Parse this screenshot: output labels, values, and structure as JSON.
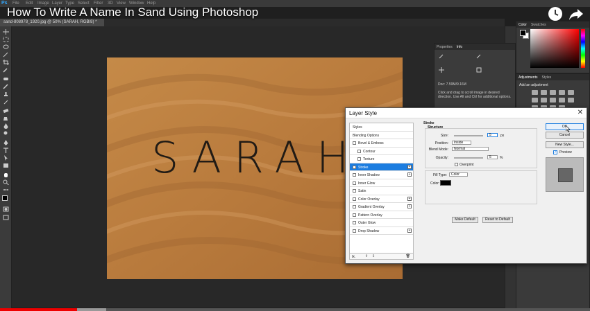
{
  "video": {
    "title": "How To Write A Name In Sand Using Photoshop",
    "progress_fraction": 0.13,
    "buffered_fraction": 0.18
  },
  "app": {
    "logo": "Ps",
    "menus": [
      "File",
      "Edit",
      "Image",
      "Layer",
      "Type",
      "Select",
      "Filter",
      "3D",
      "View",
      "Window",
      "Help"
    ],
    "doc_tab": "sand-808978_1920.jpg @ 50% (SARAH, RGB/8) *"
  },
  "canvas": {
    "word": "SARAH"
  },
  "panels": {
    "color_tabs": [
      "Color",
      "Swatches"
    ],
    "properties_tabs": [
      "Properties",
      "Info"
    ],
    "info_doc": "Doc: 7.59M/9.16M",
    "info_hint": "Click and drag to scroll image in desired direction. Use Alt and Ctrl for additional options.",
    "adjust_tabs": [
      "Adjustments",
      "Styles"
    ],
    "adjust_title": "Add an adjustment"
  },
  "dialog": {
    "title": "Layer Style",
    "list": [
      {
        "label": "Styles",
        "type": "header"
      },
      {
        "label": "Blending Options",
        "type": "header"
      },
      {
        "label": "Bevel & Emboss",
        "type": "item"
      },
      {
        "label": "Contour",
        "type": "sub"
      },
      {
        "label": "Texture",
        "type": "sub"
      },
      {
        "label": "Stroke",
        "type": "selected",
        "plus": true
      },
      {
        "label": "Inner Shadow",
        "type": "item",
        "plus": true
      },
      {
        "label": "Inner Glow",
        "type": "item"
      },
      {
        "label": "Satin",
        "type": "item"
      },
      {
        "label": "Color Overlay",
        "type": "item",
        "plus": true
      },
      {
        "label": "Gradient Overlay",
        "type": "item",
        "plus": true
      },
      {
        "label": "Pattern Overlay",
        "type": "item"
      },
      {
        "label": "Outer Glow",
        "type": "item"
      },
      {
        "label": "Drop Shadow",
        "type": "item",
        "plus": true
      }
    ],
    "footer_label": "fx.",
    "stroke": {
      "title": "Stroke",
      "structure": "Structure",
      "size_label": "Size:",
      "size_value": "5",
      "size_unit": "px",
      "position_label": "Position:",
      "position_value": "Inside",
      "blend_label": "Blend Mode:",
      "blend_value": "Normal",
      "opacity_label": "Opacity:",
      "opacity_value": "5",
      "opacity_unit": "%",
      "overprint_label": "Overprint",
      "fill_type_label": "Fill Type:",
      "fill_type_value": "Color",
      "color_label": "Color:",
      "color_value": "#000000"
    },
    "buttons": {
      "ok": "OK",
      "cancel": "Cancel",
      "new_style": "New Style...",
      "preview": "Preview",
      "make_default": "Make Default",
      "reset_default": "Reset to Default"
    }
  }
}
